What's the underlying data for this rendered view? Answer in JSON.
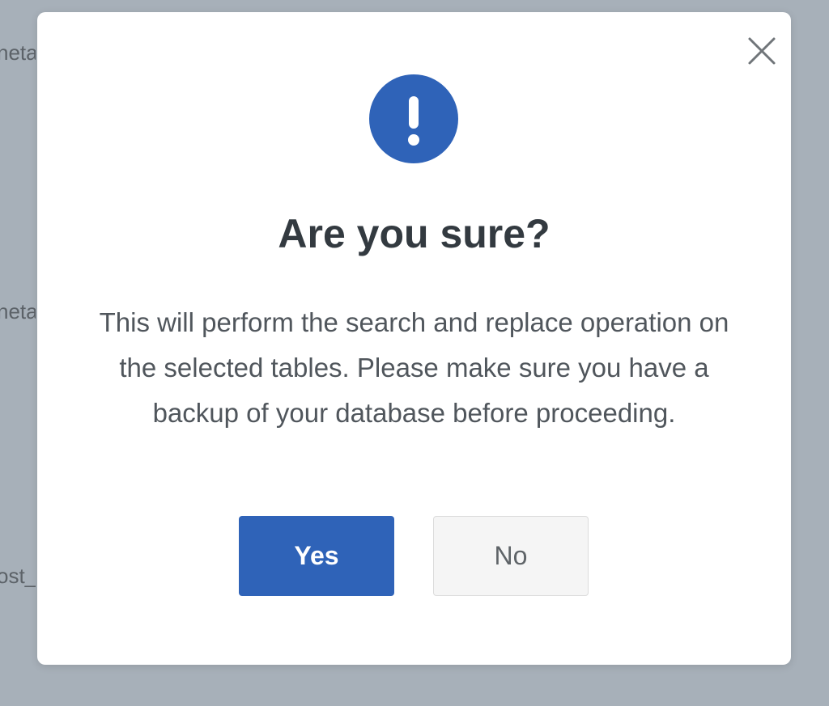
{
  "background": {
    "fragments": [
      "neta",
      "neta",
      "ost_"
    ]
  },
  "dialog": {
    "close_icon": "close-icon",
    "alert_icon": "exclamation-icon",
    "title": "Are you sure?",
    "message": "This will perform the search and replace operation on the selected tables. Please make sure you have a backup of your database before proceeding.",
    "confirm_label": "Yes",
    "cancel_label": "No"
  },
  "colors": {
    "backdrop": "#a7b0b9",
    "accent": "#2f63b8",
    "title": "#333a40",
    "message": "#50565c"
  }
}
